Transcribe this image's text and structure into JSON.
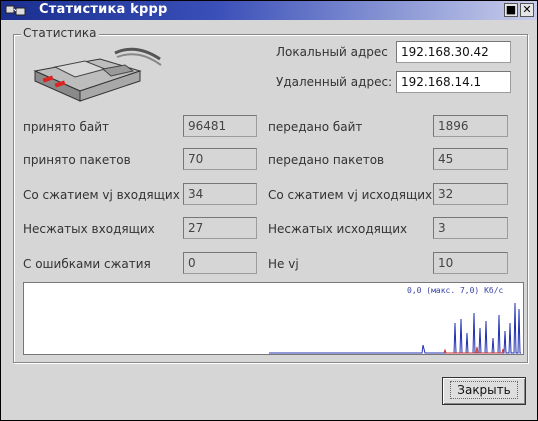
{
  "window": {
    "title": "Статистика kppp"
  },
  "group": {
    "title": "Статистика"
  },
  "addresses": {
    "local_label": "Локальный адрес",
    "local_value": "192.168.30.42",
    "remote_label": "Удаленный адрес:",
    "remote_value": "192.168.14.1"
  },
  "stats": [
    {
      "left_label": "принято байт",
      "left_value": "96481",
      "right_label": "передано байт",
      "right_value": "1896"
    },
    {
      "left_label": "принято пакетов",
      "left_value": "70",
      "right_label": "передано пакетов",
      "right_value": "45"
    },
    {
      "left_label": "Со сжатием vj входящих",
      "left_value": "34",
      "right_label": "Со сжатием vj исходящих",
      "right_value": "32"
    },
    {
      "left_label": "Несжатых входящих",
      "left_value": "27",
      "right_label": "Несжатых исходящих",
      "right_value": "3"
    },
    {
      "left_label": "С ошибками сжатия",
      "left_value": "0",
      "right_label": "Не vj",
      "right_value": "10"
    }
  ],
  "graph": {
    "legend": "0,0 (макс. 7,0) Кб/с"
  },
  "buttons": {
    "close_label": "Закрыть"
  },
  "colors": {
    "title_bar": "#1a2f8f",
    "graph_line": "#2030b0"
  }
}
